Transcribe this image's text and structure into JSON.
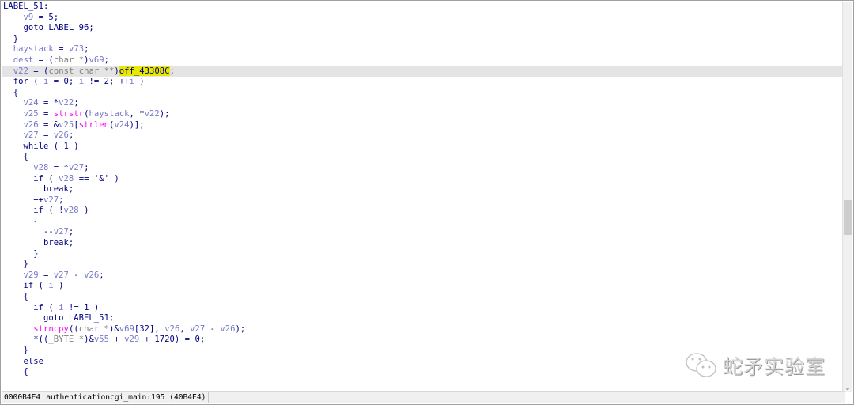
{
  "code_lines": [
    "LABEL_51:",
    "    v9 = 5;",
    "    goto LABEL_96;",
    "  }",
    "  haystack = v73;",
    "  dest = (char *)v69;",
    "  v22 = (const char **)off_43308C;",
    "  for ( i = 0; i != 2; ++i )",
    "  {",
    "    v24 = *v22;",
    "    v25 = strstr(haystack, *v22);",
    "    v26 = &v25[strlen(v24)];",
    "    v27 = v26;",
    "    while ( 1 )",
    "    {",
    "      v28 = *v27;",
    "      if ( v28 == '&' )",
    "        break;",
    "      ++v27;",
    "      if ( !v28 )",
    "      {",
    "        --v27;",
    "        break;",
    "      }",
    "    }",
    "    v29 = v27 - v26;",
    "    if ( i )",
    "    {",
    "      if ( i != 1 )",
    "        goto LABEL_51;",
    "      strncpy((char *)&v69[32], v26, v27 - v26);",
    "      *((_BYTE *)&v55 + v29 + 1720) = 0;",
    "    }",
    "    else",
    "    {"
  ],
  "highlighted_line": 6,
  "selected_token": "off_43308C",
  "status": {
    "address": "0000B4E4",
    "location": "authenticationcgi_main:195 (40B4E4)"
  },
  "watermark": {
    "text": "蛇矛实验室",
    "icon": "wechat-icon"
  },
  "colors": {
    "variable": "#7878c8",
    "function": "#ff00ff",
    "cast": "#808080",
    "text": "#000080",
    "selection": "#e8e800",
    "current_line": "#e4e4e4"
  }
}
